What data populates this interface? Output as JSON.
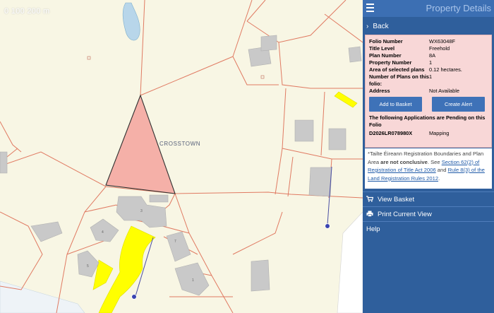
{
  "map": {
    "scale_label": "0 100 200 m",
    "townland_label": "CROSSTOWN",
    "building_numbers": [
      "3",
      "4",
      "7",
      "5",
      "1"
    ],
    "colors": {
      "selected_plot": "#f5b0a8",
      "highlight_road": "#ffff00",
      "boundary": "#e07a62",
      "building": "#c9c9c9"
    }
  },
  "panel": {
    "title": "Property Details",
    "back_label": "Back",
    "details": {
      "folio_number_label": "Folio Number",
      "folio_number": "WX63048F",
      "title_level_label": "Title Level",
      "title_level": "Freehold",
      "plan_number_label": "Plan Number",
      "plan_number": "8A",
      "property_number_label": "Property Number",
      "property_number": "1",
      "area_label": "Area of selected plans",
      "area": "0.12 hectares.",
      "plans_count_label": "Number of Plans on this folio:",
      "plans_count": "1",
      "address_label": "Address",
      "address": "Not Available",
      "add_to_basket": "Add to Basket",
      "create_alert": "Create Alert",
      "pending_heading": "The following Applications are Pending on this Folio",
      "pending_ref": "D2026LR078980X",
      "pending_type": "Mapping"
    },
    "note": {
      "part1": "*Tailte Éireann Registration Boundaries and Plan Area ",
      "bold": "are not conclusive",
      "part2": ". See ",
      "link1": "Section 62(2) of Registration of Title Act 2006",
      "part3": " and ",
      "link2": "Rule 8(3) of the Land Registration Rules 2012",
      "part4": "."
    },
    "menu": {
      "view_basket": "View Basket",
      "print": "Print Current View",
      "help": "Help"
    }
  }
}
